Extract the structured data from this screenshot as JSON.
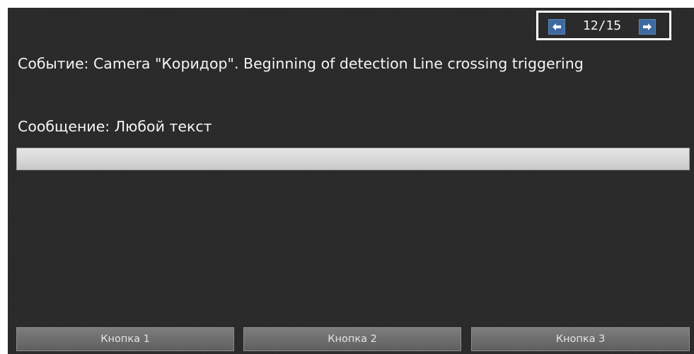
{
  "pager": {
    "counter": "12/15",
    "prev_icon": "arrow-left-icon",
    "next_icon": "arrow-right-icon",
    "accent_color": "#3f6a9f"
  },
  "event": {
    "text": "Событие: Camera \"Коридор\". Beginning of detection Line crossing triggering"
  },
  "message": {
    "text": "Сообщение: Любой текст"
  },
  "progress": {
    "value_percent": 0
  },
  "buttons": [
    {
      "label": "Кнопка 1"
    },
    {
      "label": "Кнопка 2"
    },
    {
      "label": "Кнопка 3"
    }
  ]
}
